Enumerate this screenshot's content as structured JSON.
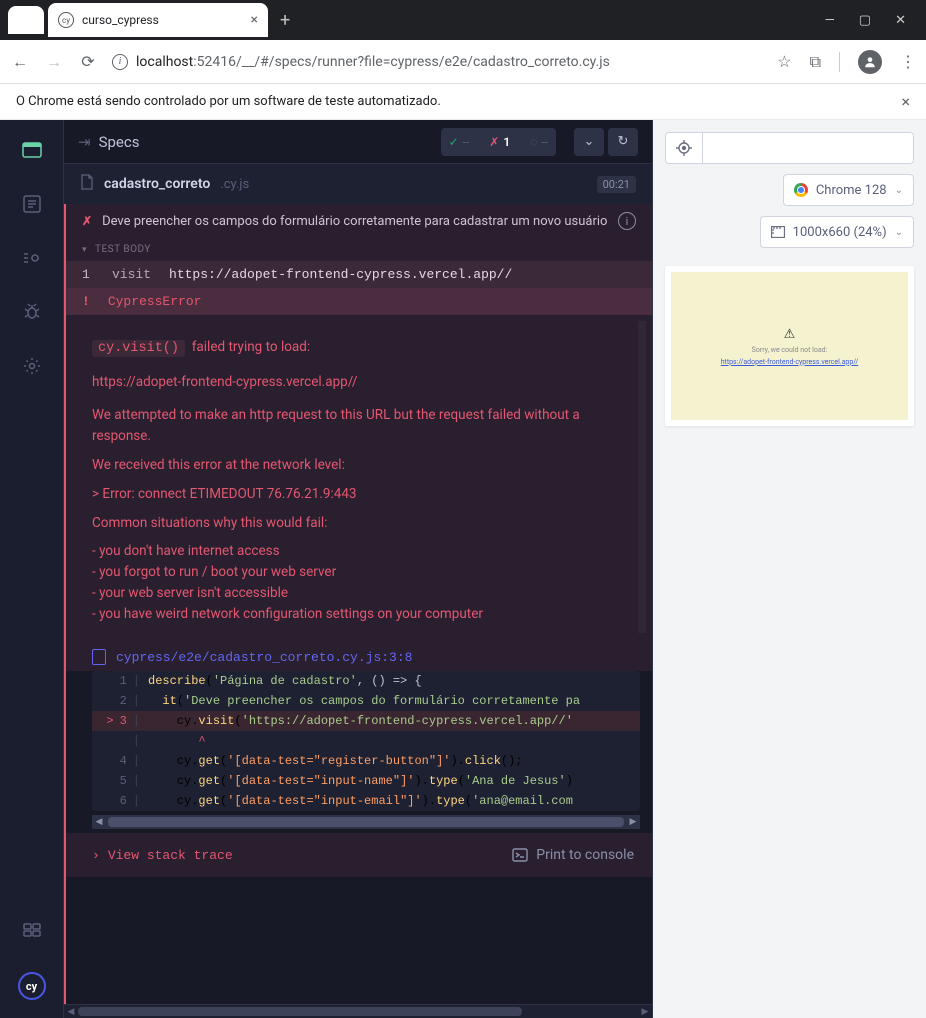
{
  "browser": {
    "tab_title": "curso_cypress",
    "url_host": "localhost",
    "url_port": ":52416",
    "url_path": "/__/#/specs/runner?file=cypress/e2e/cadastro_correto.cy.js",
    "banner": "O Chrome está sendo controlado por um software de teste automatizado."
  },
  "reporter": {
    "specs_label": "Specs",
    "passed": "--",
    "failed": "1",
    "pending": "--",
    "spec_name": "cadastro_correto",
    "spec_ext": ".cy.js",
    "duration": "00:21",
    "test_title": "Deve preencher os campos do formulário corretamente para cadastrar um novo usuário",
    "section_label": "TEST BODY",
    "cmd_num": "1",
    "cmd_name": "visit",
    "cmd_url": "https://adopet-frontend-cypress.vercel.app//",
    "err_name": "CypressError",
    "err_code": "cy.visit()",
    "err_l1": "failed trying to load:",
    "err_url": "https://adopet-frontend-cypress.vercel.app//",
    "err_p1": "We attempted to make an http request to this URL but the request failed without a response.",
    "err_p2": "We received this error at the network level:",
    "err_p3": "> Error: connect ETIMEDOUT 76.76.21.9:443",
    "err_p4": "Common situations why this would fail:",
    "err_b1": "- you don't have internet access",
    "err_b2": "- you forgot to run / boot your web server",
    "err_b3": "- your web server isn't accessible",
    "err_b4": "- you have weird network configuration settings on your computer",
    "code_file": "cypress/e2e/cadastro_correto.cy.js:3:8",
    "code": {
      "l1": {
        "n": "1",
        "pre": "",
        "fn1": "describe",
        "s1": "'Página de cadastro'",
        "rest": ", () => {"
      },
      "l2": {
        "n": "2",
        "pre": "  ",
        "fn1": "it",
        "s1": "'Deve preencher os campos do formulário corretamente pa"
      },
      "l3": {
        "n": "3",
        "marker": ">",
        "pre": "    cy.",
        "fn1": "visit",
        "s1": "'https://adopet-frontend-cypress.vercel.app//'"
      },
      "lcaret": {
        "caret": "       ^"
      },
      "l4": {
        "n": "4",
        "pre": "    cy.",
        "fn1": "get",
        "sel": "'[data-test=\"register-button\"]'",
        "mid": ").",
        "fn2": "click",
        "rest": "();"
      },
      "l5": {
        "n": "5",
        "pre": "    cy.",
        "fn1": "get",
        "sel": "'[data-test=\"input-name\"]'",
        "mid": ").",
        "fn2": "type",
        "s2": "'Ana de Jesus'",
        "rest": ")"
      },
      "l6": {
        "n": "6",
        "pre": "    cy.",
        "fn1": "get",
        "sel": "'[data-test=\"input-email\"]'",
        "mid": ").",
        "fn2": "type",
        "s2": "'ana@email.com"
      }
    },
    "stack_trace": "View stack trace",
    "print_console": "Print to console"
  },
  "aut": {
    "browser_label": "Chrome 128",
    "viewport_label": "1000x660 (24%)",
    "err_msg": "Sorry, we could not load:",
    "err_link": "https://adopet-frontend-cypress.vercel.app//"
  }
}
